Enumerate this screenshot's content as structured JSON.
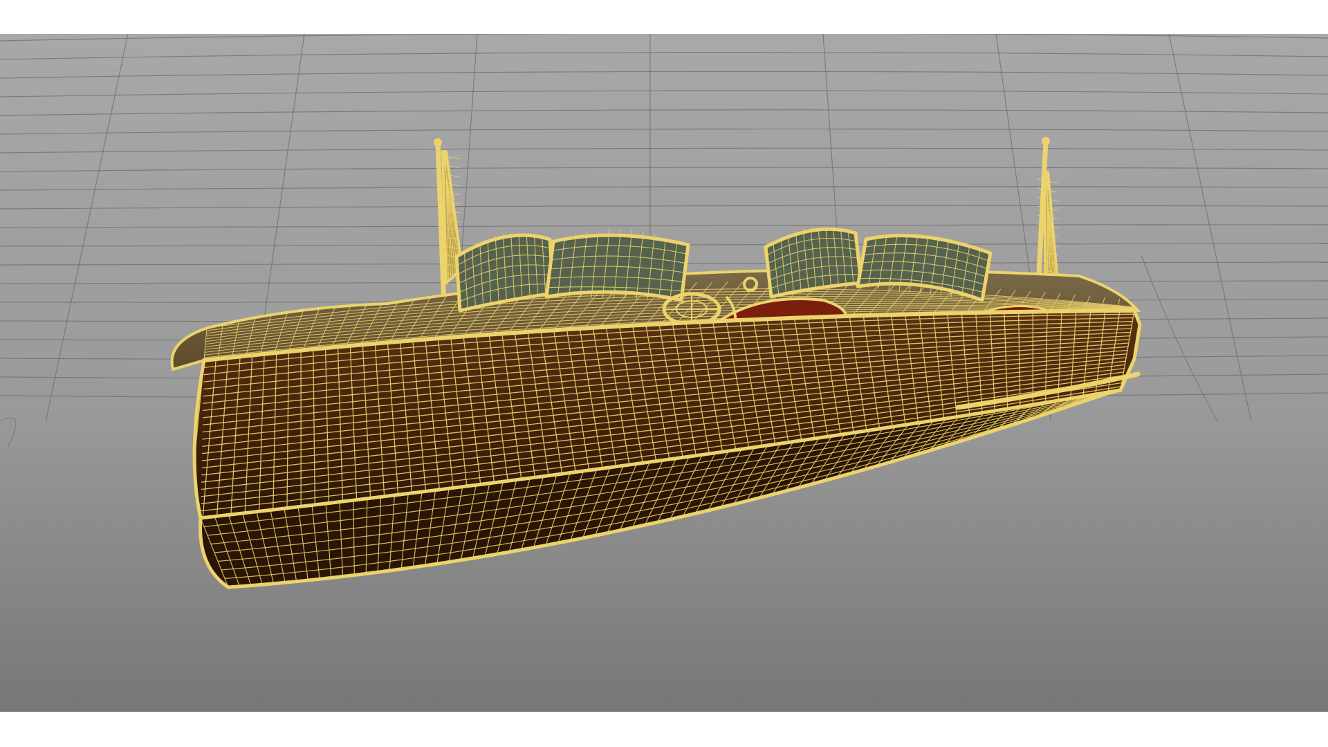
{
  "viewport": {
    "background_top": "#a8a8a8",
    "background_bottom": "#777777",
    "grid_color": "#6e6e6e",
    "wire_color": "#ecd36c",
    "hull_color": "#4a2810",
    "hull_dark": "#2b1606",
    "glass_color": "#55624e",
    "cockpit_color": "#7a1f0e"
  },
  "model": {
    "name_icon": "speedboat-wireframe-icon",
    "display_mode": "wireframe-on-shaded"
  }
}
